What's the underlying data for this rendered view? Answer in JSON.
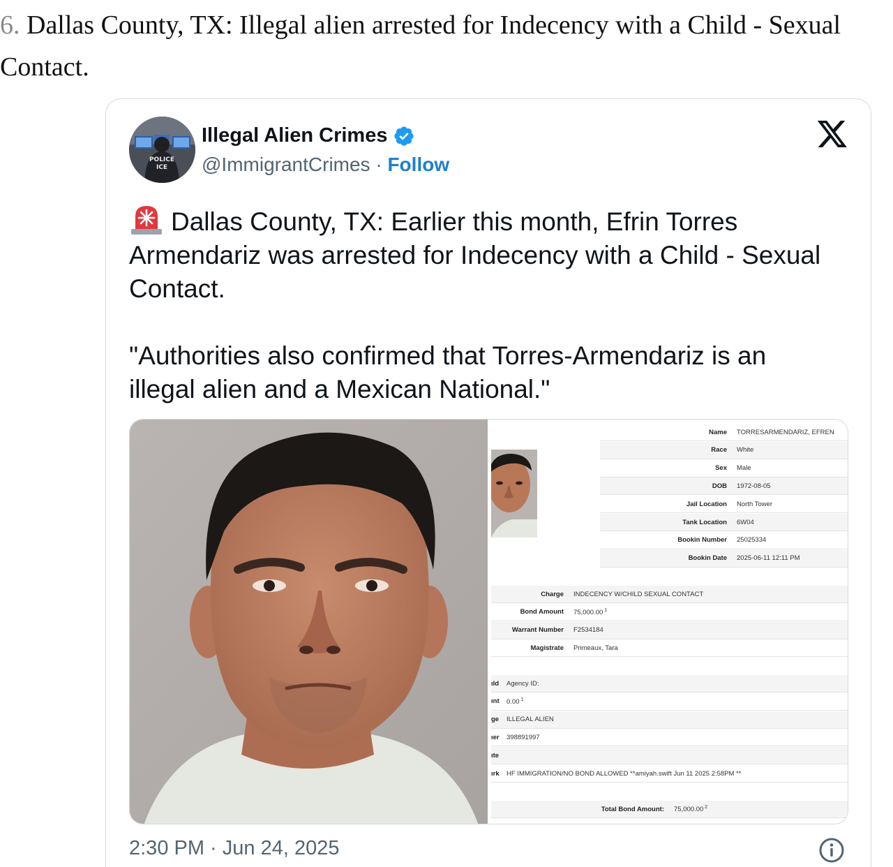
{
  "heading": {
    "number": "6.",
    "line1": "Dallas County, TX: Illegal alien arrested for Indecency with a Child - Sexual",
    "line2": "Contact."
  },
  "tweet": {
    "author_name": "Illegal Alien Crimes",
    "handle": "@ImmigrantCrimes",
    "separator": "·",
    "follow_label": "Follow",
    "avatar_vest_line1": "POLICE",
    "avatar_vest_line2": "ICE",
    "paragraph1": "Dallas County, TX: Earlier this month, Efrin Torres Armendariz was arrested for Indecency with a Child - Sexual Contact.",
    "paragraph2": "\"Authorities also confirmed that Torres-Armendariz is an illegal alien and a Mexican National.\"",
    "timestamp": "2:30 PM · Jun 24, 2025",
    "icons": [
      "siren-emoji",
      "verified-badge",
      "x-logo",
      "info-icon"
    ],
    "colors": {
      "verified": "#1d9bf0",
      "follow": "#1d7fd0",
      "muted": "#536471"
    }
  },
  "booking_record": {
    "person": [
      {
        "label": "Name",
        "value": "TORRESARMENDARIZ, EFREN"
      },
      {
        "label": "Race",
        "value": "White"
      },
      {
        "label": "Sex",
        "value": "Male"
      },
      {
        "label": "DOB",
        "value": "1972-08-05"
      },
      {
        "label": "Jail Location",
        "value": "North Tower"
      },
      {
        "label": "Tank Location",
        "value": "6W04"
      },
      {
        "label": "Bookin Number",
        "value": "25025334"
      },
      {
        "label": "Bookin Date",
        "value": "2025-06-11 12:11 PM"
      }
    ],
    "charge": [
      {
        "label": "Charge",
        "value": "INDECENCY W/CHILD SEXUAL CONTACT"
      },
      {
        "label": "Bond Amount",
        "value": "75,000.00",
        "sup": "1"
      },
      {
        "label": "Warrant Number",
        "value": "F2534184"
      },
      {
        "label": "Magistrate",
        "value": "Primeaux, Tara"
      }
    ],
    "hold": [
      {
        "label": "ıld",
        "value": "Agency ID:"
      },
      {
        "label": "ınt",
        "value": "0.00",
        "sup": "1"
      },
      {
        "label": "ge",
        "value": "ILLEGAL ALIEN"
      },
      {
        "label": "ıer",
        "value": "398891997"
      },
      {
        "label": "ıte",
        "value": ""
      },
      {
        "label": "ırk",
        "value": "HF IMMIGRATION/NO BOND ALLOWED **amiyah.swift Jun 11 2025 2:58PM **"
      }
    ],
    "total": {
      "label": "Total Bond Amount:",
      "value": "75,000.00",
      "sup": "2"
    }
  }
}
